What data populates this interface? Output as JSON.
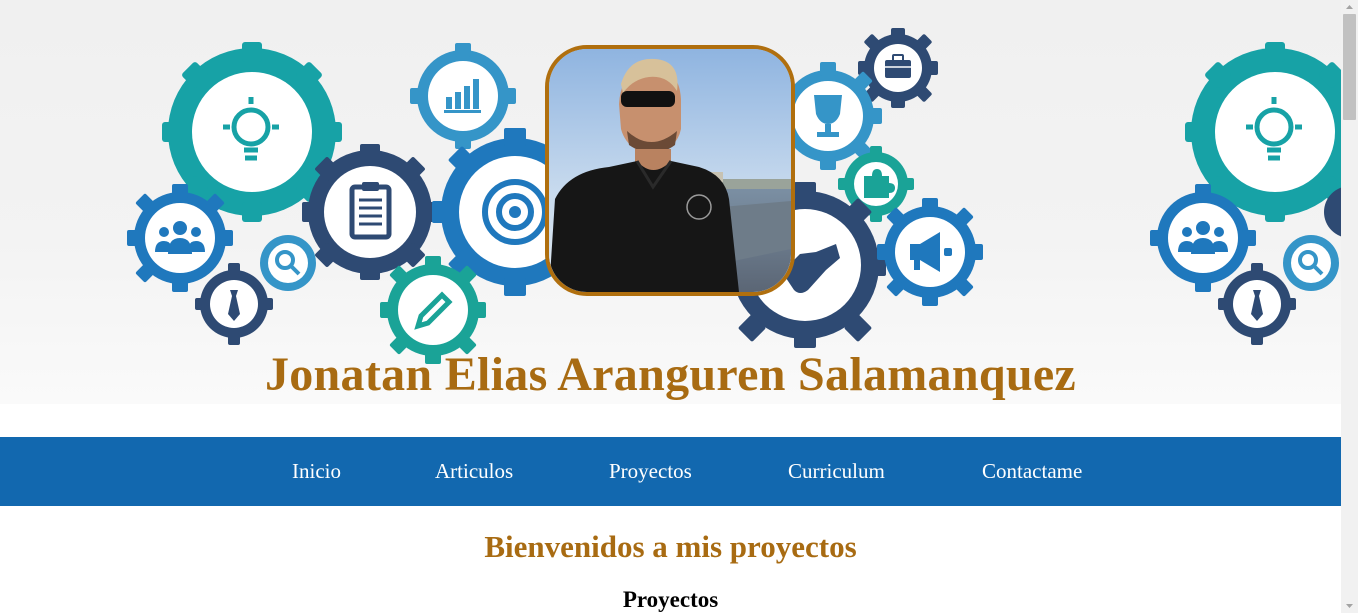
{
  "header": {
    "name": "Jonatan Elias Aranguren Salamanquez",
    "title_color": "#a86b12",
    "photo_border_color": "#b06f0e"
  },
  "nav": {
    "background": "#1268af",
    "items": [
      {
        "label": "Inicio"
      },
      {
        "label": "Articulos"
      },
      {
        "label": "Proyectos"
      },
      {
        "label": "Curriculum"
      },
      {
        "label": "Contactame"
      }
    ]
  },
  "main": {
    "welcome": "Bienvenidos a mis proyectos",
    "section_title": "Proyectos"
  },
  "banner": {
    "icons": [
      "lightbulb-icon",
      "chart-icon",
      "clipboard-icon",
      "target-icon",
      "team-icon",
      "search-icon",
      "tie-icon",
      "pencil-icon",
      "briefcase-icon",
      "trophy-icon",
      "puzzle-icon",
      "handshake-icon",
      "megaphone-icon"
    ],
    "colors": {
      "teal": "#17a2a6",
      "navy": "#2e4a73",
      "blue": "#1f78bd",
      "light_blue": "#3595c8",
      "green": "#1aa397"
    }
  }
}
